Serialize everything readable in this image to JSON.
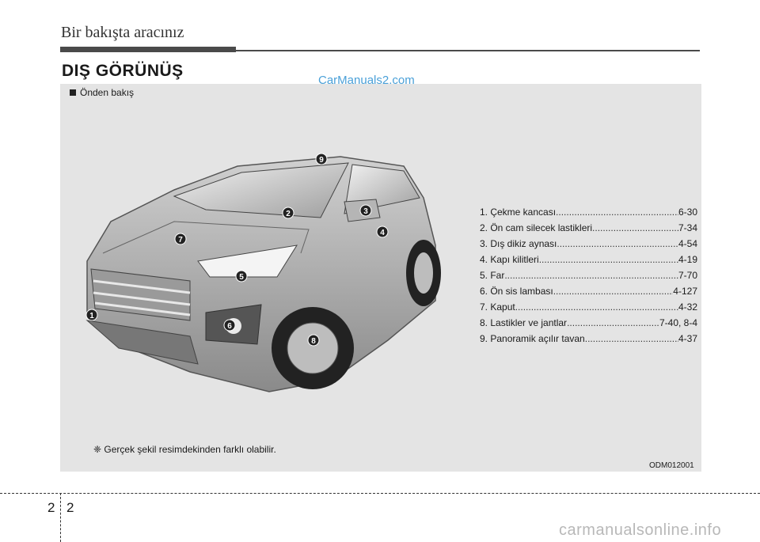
{
  "header": {
    "title": "Bir bakışta aracınız"
  },
  "section_title": "DIŞ GÖRÜNÜŞ",
  "watermark": "CarManuals2.com",
  "panel": {
    "subtitle": "Önden bakış",
    "legend": [
      {
        "label": "1. Çekme kancası",
        "page": "6-30"
      },
      {
        "label": "2. Ön cam silecek lastikleri",
        "page": "7-34"
      },
      {
        "label": "3. Dış dikiz aynası",
        "page": "4-54"
      },
      {
        "label": "4. Kapı kilitleri",
        "page": "4-19"
      },
      {
        "label": "5. Far",
        "page": "7-70"
      },
      {
        "label": "6. Ön sis lambası",
        "page": "4-127"
      },
      {
        "label": "7. Kaput",
        "page": "4-32"
      },
      {
        "label": "8. Lastikler ve jantlar",
        "page": "7-40, 8-4"
      },
      {
        "label": "9. Panoramik açılır tavan",
        "page": "4-37"
      }
    ],
    "callouts": [
      "1",
      "2",
      "3",
      "4",
      "5",
      "6",
      "7",
      "8",
      "9"
    ],
    "note": "❈ Gerçek şekil resimdekinden farklı olabilir.",
    "image_code": "ODM012001"
  },
  "footer": {
    "page_left": "2",
    "page_right": "2",
    "site": "carmanualsonline.info"
  }
}
